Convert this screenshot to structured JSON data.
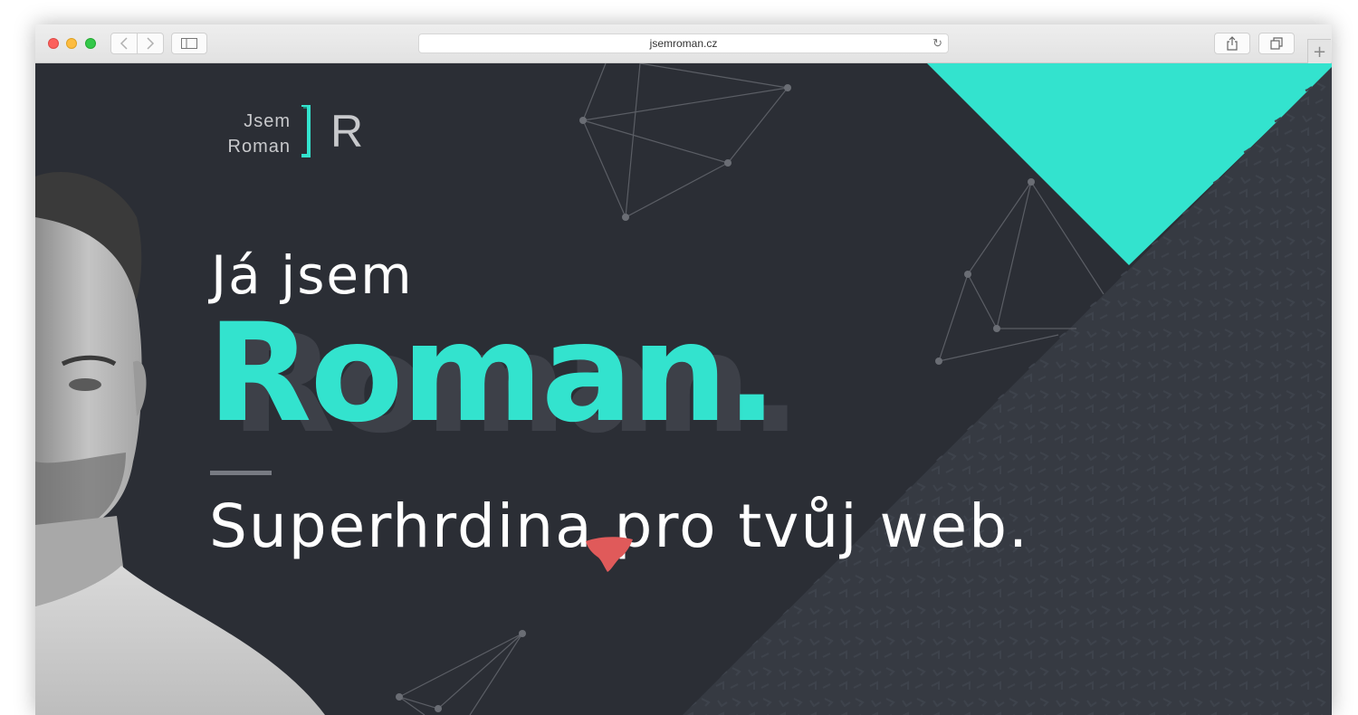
{
  "browser": {
    "url": "jsemroman.cz",
    "icons": {
      "back": "chevron-left-icon",
      "forward": "chevron-right-icon",
      "sidebar": "sidebar-icon",
      "reload": "reload-icon",
      "share": "share-icon",
      "tabs": "tabs-icon",
      "new_tab": "plus-icon"
    }
  },
  "logo": {
    "line1": "Jsem",
    "line2": "Roman",
    "letter": "R"
  },
  "hero": {
    "intro": "Já jsem",
    "name": "Roman.",
    "tagline": "Superhrdina pro tvůj web."
  },
  "colors": {
    "background": "#2b2e35",
    "accent": "#33e3ce",
    "pattern": "#3e434c",
    "cape": "#e05a5a",
    "text": "#ffffff"
  }
}
